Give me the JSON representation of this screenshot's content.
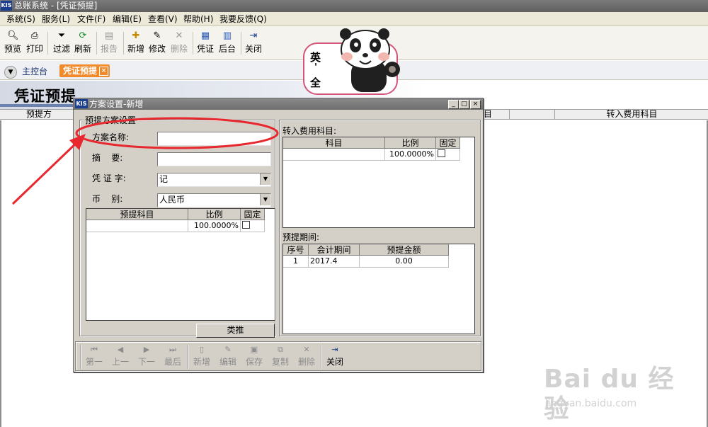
{
  "window": {
    "app_logo": "KIS",
    "title": "总账系统 - [凭证预提]"
  },
  "menu": [
    "系统(S)",
    "服务(L)",
    "文件(F)",
    "编辑(E)",
    "查看(V)",
    "帮助(H)",
    "我要反馈(Q)"
  ],
  "toolbar": [
    {
      "label": "预览",
      "icon": "preview-icon"
    },
    {
      "label": "打印",
      "icon": "printer-icon"
    },
    {
      "label": "过滤",
      "icon": "filter-icon"
    },
    {
      "label": "刷新",
      "icon": "refresh-icon"
    },
    {
      "label": "报告",
      "icon": "report-icon",
      "disabled": true
    },
    {
      "label": "新增",
      "icon": "add-icon"
    },
    {
      "label": "修改",
      "icon": "edit-icon"
    },
    {
      "label": "删除",
      "icon": "delete-icon",
      "disabled": true
    },
    {
      "label": "凭证",
      "icon": "voucher-icon"
    },
    {
      "label": "后台",
      "icon": "background-icon"
    },
    {
      "label": "关闭",
      "icon": "close-door-icon"
    }
  ],
  "tabs": {
    "home": "主控台",
    "active": "凭证预提"
  },
  "page": {
    "banner_title": "凭证预提",
    "grid_headers": [
      "预提方",
      "目",
      "转入费用科目"
    ]
  },
  "dialog": {
    "logo": "KIS",
    "title": "方案设置-新增",
    "group_title": "预提方案设置",
    "fields": {
      "scheme_name_label": "方案名称:",
      "scheme_name_value": "",
      "summary_label": "摘    要:",
      "summary_value": "",
      "voucher_word_label": "凭 证 字:",
      "voucher_word_value": "记",
      "currency_label": "币    别:",
      "currency_value": "人民币"
    },
    "accrual_grid": {
      "headers": [
        "预提科目",
        "比例",
        "固定"
      ],
      "rows": [
        {
          "account": "",
          "ratio": "100.0000%",
          "fixed": false
        }
      ]
    },
    "extrapolate_button": "类推",
    "expense_section": {
      "label": "转入费用科目:",
      "headers": [
        "科目",
        "比例",
        "固定"
      ],
      "rows": [
        {
          "account": "",
          "ratio": "100.0000%",
          "fixed": false
        }
      ]
    },
    "period_section": {
      "label": "预提期间:",
      "headers": [
        "序号",
        "会计期间",
        "预提金额"
      ],
      "rows": [
        {
          "no": "1",
          "period": "2017.4",
          "amount": "0.00"
        }
      ]
    },
    "nav": [
      {
        "label": "第一",
        "icon": "first-icon",
        "enabled": false
      },
      {
        "label": "上一",
        "icon": "prev-icon",
        "enabled": false
      },
      {
        "label": "下一",
        "icon": "next-icon",
        "enabled": false
      },
      {
        "label": "最后",
        "icon": "last-icon",
        "enabled": false
      },
      {
        "label": "新增",
        "icon": "new-doc-icon",
        "enabled": false
      },
      {
        "label": "编辑",
        "icon": "edit-icon",
        "enabled": false
      },
      {
        "label": "保存",
        "icon": "save-icon",
        "enabled": false
      },
      {
        "label": "复制",
        "icon": "copy-icon",
        "enabled": false
      },
      {
        "label": "删除",
        "icon": "delete-icon",
        "enabled": false
      },
      {
        "label": "关闭",
        "icon": "close-door-icon",
        "enabled": true
      }
    ]
  },
  "sticker": {
    "chars": [
      "英",
      "'",
      "全"
    ]
  },
  "watermark": {
    "main": "Bai du 经验",
    "sub": "jingyan.baidu.com"
  },
  "colors": {
    "tab_accent": "#f08a2b",
    "annotation_red": "#e8282e",
    "sticker_border": "#d1567a"
  }
}
